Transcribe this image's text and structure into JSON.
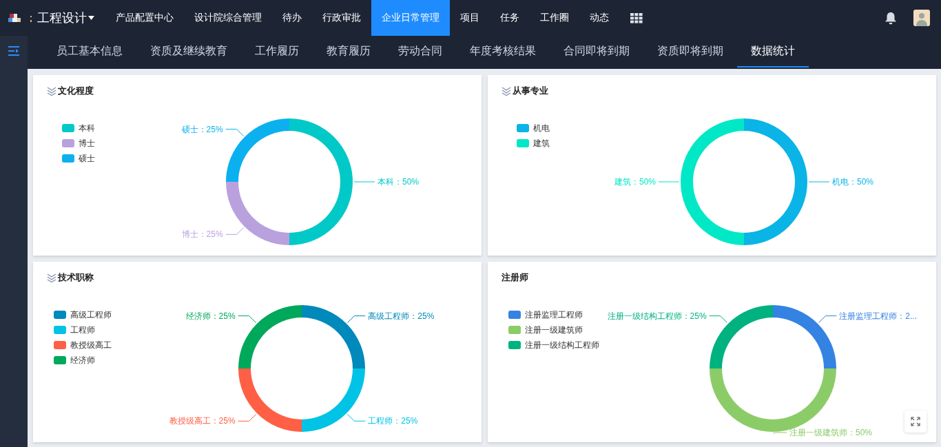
{
  "top_nav": {
    "app_name": "工程设计",
    "items": [
      {
        "label": "产品配置中心",
        "selected": false
      },
      {
        "label": "设计院综合管理",
        "selected": false
      },
      {
        "label": "待办",
        "selected": false
      },
      {
        "label": "行政审批",
        "selected": false
      },
      {
        "label": "企业日常管理",
        "selected": true
      },
      {
        "label": "项目",
        "selected": false
      },
      {
        "label": "任务",
        "selected": false
      },
      {
        "label": "工作圈",
        "selected": false
      },
      {
        "label": "动态",
        "selected": false
      }
    ]
  },
  "sub_tabs": [
    {
      "label": "员工基本信息",
      "selected": false
    },
    {
      "label": "资质及继续教育",
      "selected": false
    },
    {
      "label": "工作履历",
      "selected": false
    },
    {
      "label": "教育履历",
      "selected": false
    },
    {
      "label": "劳动合同",
      "selected": false
    },
    {
      "label": "年度考核结果",
      "selected": false
    },
    {
      "label": "合同即将到期",
      "selected": false
    },
    {
      "label": "资质即将到期",
      "selected": false
    },
    {
      "label": "数据统计",
      "selected": true
    }
  ],
  "cards": [
    {
      "title": "文化程度",
      "title_icon": true,
      "chart_data": {
        "type": "donut",
        "categories": [
          "本科",
          "博士",
          "硕士"
        ],
        "colors": [
          "#00c9c8",
          "#b9a1dd",
          "#0bb0ef"
        ],
        "series": [
          {
            "values": [
              50,
              25,
              25
            ]
          }
        ],
        "value_labels": [
          "本科：50%",
          "博士：25%",
          "硕士：25%"
        ]
      }
    },
    {
      "title": "从事专业",
      "title_icon": true,
      "chart_data": {
        "type": "donut",
        "categories": [
          "机电",
          "建筑"
        ],
        "colors": [
          "#0ab4e6",
          "#00e8c6"
        ],
        "series": [
          {
            "values": [
              50,
              50
            ]
          }
        ],
        "value_labels": [
          "机电：50%",
          "建筑：50%"
        ]
      }
    },
    {
      "title": "技术职称",
      "title_icon": true,
      "chart_data": {
        "type": "donut",
        "categories": [
          "高级工程师",
          "工程师",
          "教授级高工",
          "经济师"
        ],
        "colors": [
          "#0089bb",
          "#00c3e6",
          "#ff5f45",
          "#00a85b"
        ],
        "series": [
          {
            "values": [
              25,
              25,
              25,
              25
            ]
          }
        ],
        "value_labels": [
          "高级工程师：25%",
          "工程师：25%",
          "教授级高工：25%",
          "经济师：25%"
        ]
      }
    },
    {
      "title": "注册师",
      "title_icon": false,
      "chart_data": {
        "type": "donut",
        "categories": [
          "注册监理工程师",
          "注册一级建筑师",
          "注册一级结构工程师"
        ],
        "colors": [
          "#3483e2",
          "#8ccc68",
          "#00b27f"
        ],
        "series": [
          {
            "values": [
              25,
              50,
              25
            ]
          }
        ],
        "value_labels": [
          "注册监理工程师：2...",
          "注册一级建筑师：50%",
          "注册一级结构工程师：25%"
        ]
      }
    }
  ]
}
